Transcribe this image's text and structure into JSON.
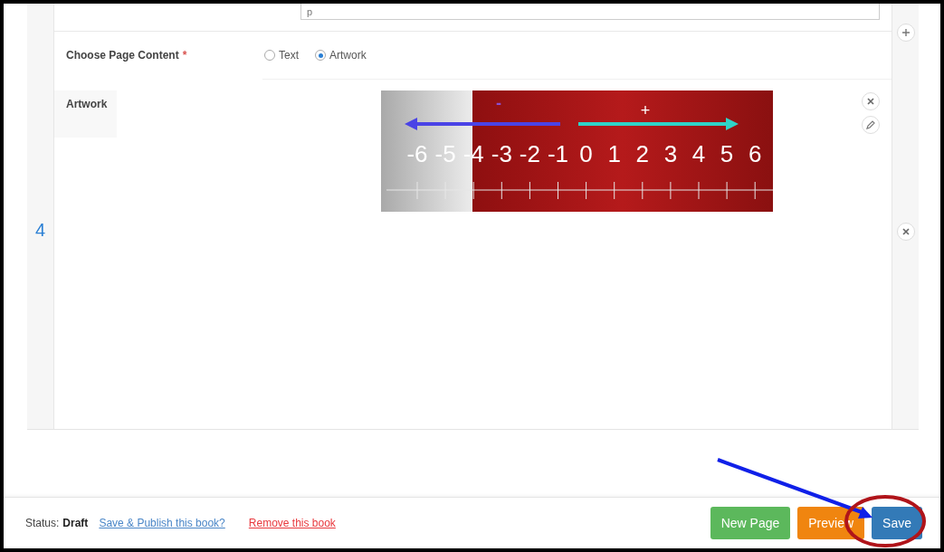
{
  "top_field": {
    "value": "p"
  },
  "page_number": "4",
  "content_choice": {
    "label": "Choose Page Content",
    "required_mark": "*",
    "options": [
      {
        "label": "Text",
        "selected": false
      },
      {
        "label": "Artwork",
        "selected": true
      }
    ]
  },
  "artwork": {
    "label": "Artwork",
    "negative_sign": "-",
    "positive_sign": "+",
    "numbers": [
      "-6",
      "-5",
      "-4",
      "-3",
      "-2",
      "-1",
      "0",
      "1",
      "2",
      "3",
      "4",
      "5",
      "6"
    ]
  },
  "footer": {
    "status_label": "Status:",
    "status": "Draft",
    "links": [
      {
        "label": "Save & Publish this book?",
        "kind": "publish"
      },
      {
        "label": "Remove this book",
        "kind": "danger"
      }
    ],
    "buttons": [
      {
        "label": "New Page",
        "kind": "success"
      },
      {
        "label": "Preview",
        "kind": "warning"
      },
      {
        "label": "Save",
        "kind": "primary"
      }
    ]
  },
  "annotation": {
    "arrow": true,
    "circle": true
  }
}
